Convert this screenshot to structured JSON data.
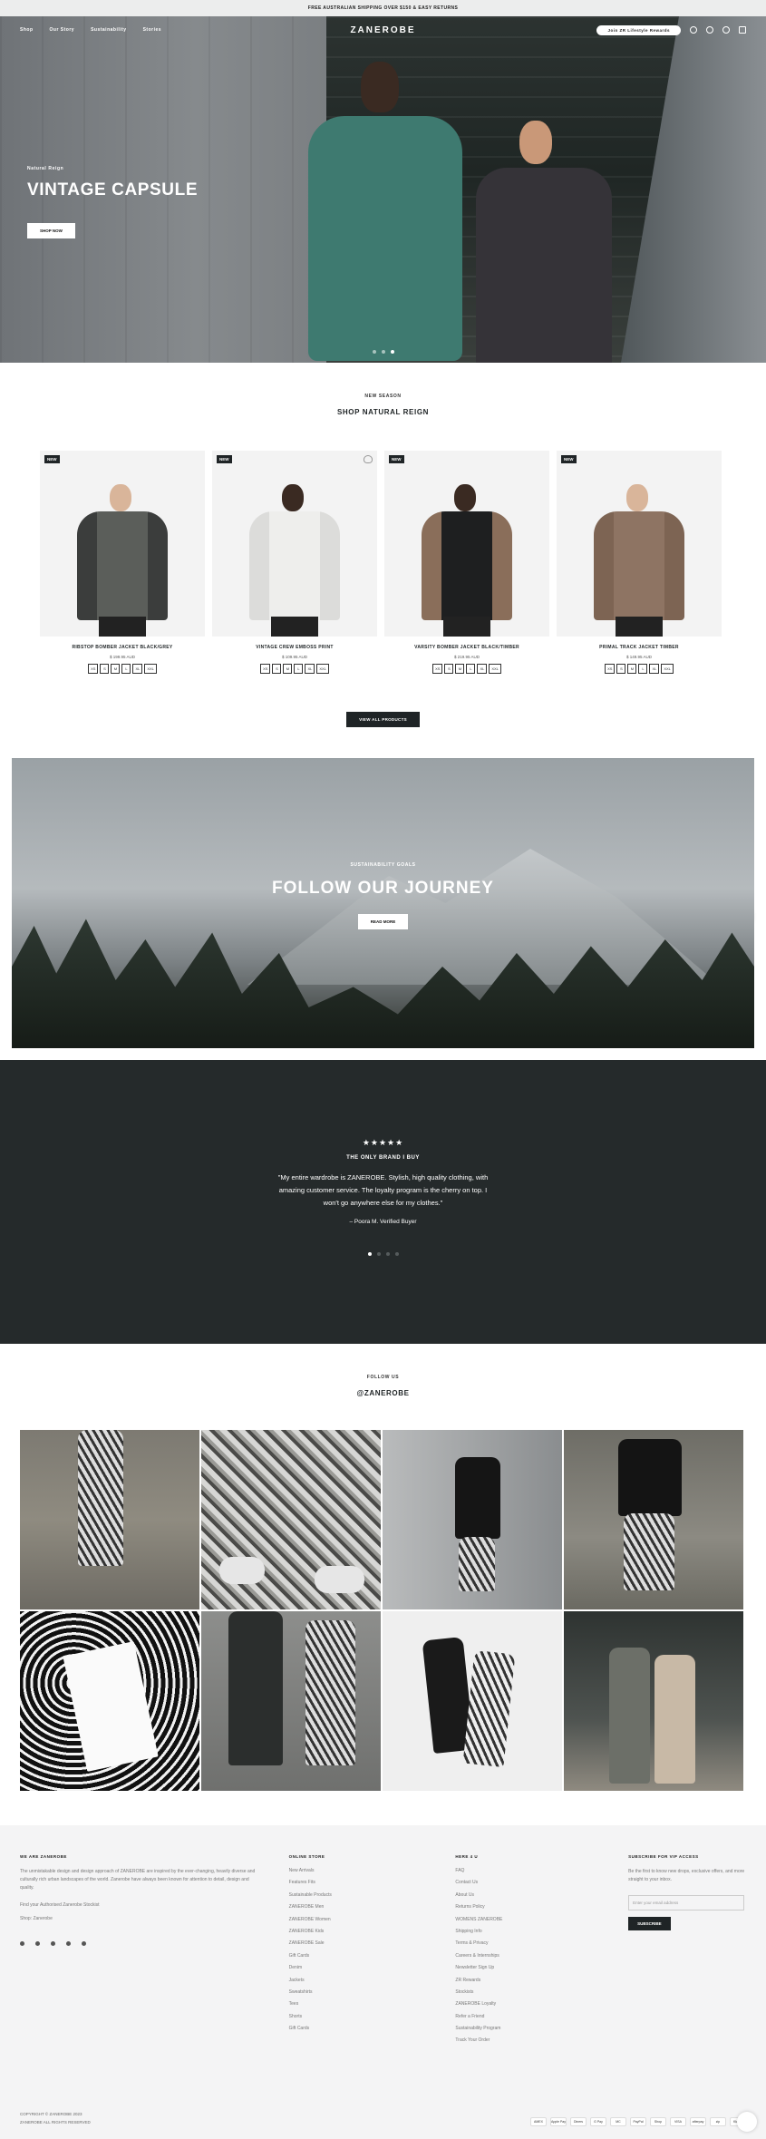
{
  "announcement": "Free Australian shipping over $150 & easy returns",
  "nav": {
    "logo": "ZANEROBE",
    "links": [
      "Shop",
      "Our Story",
      "Sustainability",
      "Stories"
    ],
    "loyalty_label": "Join ZR Lifestyle Rewards"
  },
  "hero": {
    "eyebrow": "Natural Reign",
    "title": "VINTAGE CAPSULE",
    "button": "SHOP NOW"
  },
  "products": {
    "eyebrow": "NEW SEASON",
    "title": "SHOP NATURAL REIGN",
    "view_all": "VIEW ALL PRODUCTS",
    "items": [
      {
        "badge": "NEW",
        "name": "RIBSTOP BOMBER JACKET BLACK/GREY",
        "price": "$ 199.95 AUD",
        "sizes": [
          "XS",
          "S",
          "M",
          "L",
          "XL",
          "XXL"
        ],
        "colors": {
          "body": "#5b5e5a",
          "sleeve": "#3b3d3c",
          "head": "#d9b59a"
        }
      },
      {
        "badge": "NEW",
        "name": "VINTAGE CREW EMBOSS PRINT",
        "price": "$ 109.95 AUD",
        "sizes": [
          "XS",
          "S",
          "M",
          "L",
          "XL",
          "XXL"
        ],
        "colors": {
          "body": "#eeeeec",
          "sleeve": "#dcdcda",
          "head": "#3a2a22"
        }
      },
      {
        "badge": "NEW",
        "name": "VARSITY BOMBER JACKET BLACK/TIMBER",
        "price": "$ 219.95 AUD",
        "sizes": [
          "XS",
          "S",
          "M",
          "L",
          "XL",
          "XXL"
        ],
        "colors": {
          "body": "#1e1f20",
          "sleeve": "#8a6e5a",
          "head": "#3a2a22"
        }
      },
      {
        "badge": "NEW",
        "name": "PRIMAL TRACK JACKET TIMBER",
        "price": "$ 149.95 AUD",
        "sizes": [
          "XS",
          "S",
          "M",
          "L",
          "XL",
          "XXL"
        ],
        "colors": {
          "body": "#8e7463",
          "sleeve": "#7d6453",
          "head": "#d9b59a"
        }
      }
    ]
  },
  "journey": {
    "eyebrow": "SUSTAINABILITY GOALS",
    "title": "FOLLOW OUR JOURNEY",
    "button": "READ MORE"
  },
  "testimonial": {
    "stars": "★★★★★",
    "heading": "THE ONLY BRAND I BUY",
    "quote": "\"My entire wardrobe is ZANEROBE. Stylish, high quality clothing, with amazing customer service. The loyalty program is the cherry on top. I won't go anywhere else for my clothes.\"",
    "author": "– Poora M. Verified Buyer"
  },
  "instagram": {
    "eyebrow": "FOLLOW US",
    "handle": "@ZANEROBE"
  },
  "footer": {
    "about": {
      "heading": "WE ARE ZANEROBE",
      "text": "The unmistakable design and design approach of ZANEROBE are inspired by the ever-changing, heavily diverse and culturally rich urban landscapes of the world. Zanerobe have always been known for attention to detail, design and quality.",
      "extra": "Find your Authorised Zanerobe Stockist",
      "email": "Shop: Zanerobe"
    },
    "store": {
      "heading": "ONLINE STORE",
      "links": [
        "New Arrivals",
        "Features Fits",
        "Sustainable Products",
        "ZANEROBE Men",
        "ZANEROBE Women",
        "ZANEROBE Kids",
        "ZANEROBE Sale",
        "Gift Cards",
        "Denim",
        "Jackets",
        "Sweatshirts",
        "Tees",
        "Shorts",
        "Gift Cards"
      ]
    },
    "help": {
      "heading": "HERE 4 U",
      "links": [
        "FAQ",
        "Contact Us",
        "About Us",
        "Returns Policy",
        "WOMENS ZANEROBE",
        "Shipping Info",
        "Terms & Privacy",
        "Careers & Internships",
        "Newsletter Sign Up",
        "ZR Rewards",
        "Stockists",
        "ZANEROBE Loyalty",
        "Refer a Friend",
        "Sustainability Program",
        "Track Your Order"
      ]
    },
    "newsletter": {
      "heading": "SUBSCRIBE FOR VIP ACCESS",
      "text": "Be the first to know new drops, exclusive offers, and more straight to your inbox.",
      "placeholder": "Enter your email address",
      "button": "SUBSCRIBE"
    },
    "copyright": "COPYRIGHT © ZANEROBE 2023",
    "powered": "ZANEROBE ALL RIGHTS RESERVED",
    "payments": [
      "AMEX",
      "Apple Pay",
      "Diners",
      "G Pay",
      "MC",
      "PayPal",
      "Shop",
      "VISA",
      "afterpay",
      "zip",
      "Klarna"
    ]
  }
}
